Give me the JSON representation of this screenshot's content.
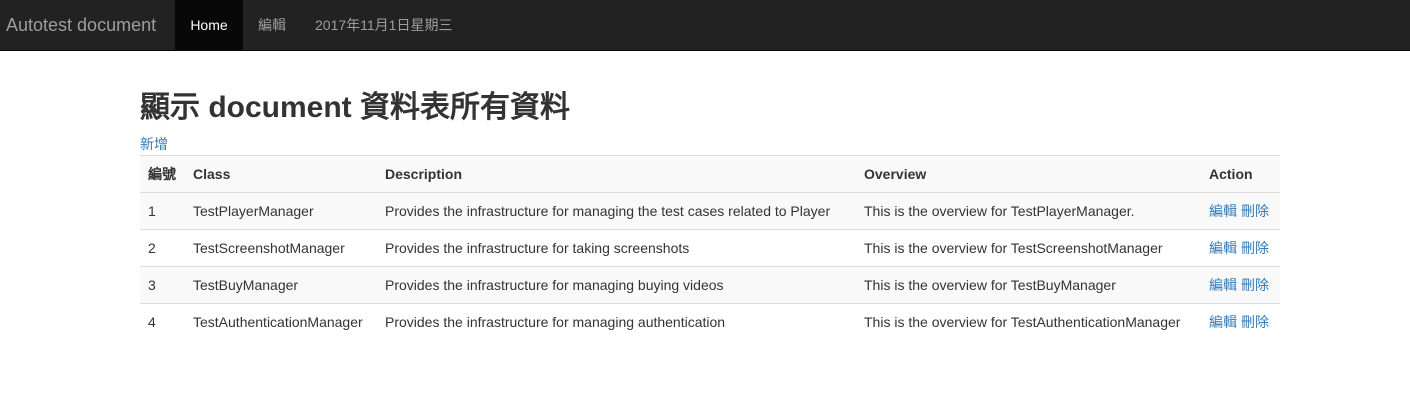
{
  "navbar": {
    "brand": "Autotest document",
    "items": [
      {
        "label": "Home"
      },
      {
        "label": "編輯"
      },
      {
        "label": "2017年11月1日星期三"
      }
    ]
  },
  "main": {
    "title": "顯示 document 資料表所有資料",
    "add_label": "新增",
    "table": {
      "headers": [
        "編號",
        "Class",
        "Description",
        "Overview",
        "Action"
      ],
      "rows": [
        {
          "id": "1",
          "class": "TestPlayerManager",
          "description": "Provides the infrastructure for managing the test cases related to Player",
          "overview": "This is the overview for TestPlayerManager.",
          "edit": "編輯",
          "delete": "刪除"
        },
        {
          "id": "2",
          "class": "TestScreenshotManager",
          "description": "Provides the infrastructure for taking screenshots",
          "overview": "This is the overview for TestScreenshotManager",
          "edit": "編輯",
          "delete": "刪除"
        },
        {
          "id": "3",
          "class": "TestBuyManager",
          "description": "Provides the infrastructure for managing buying videos",
          "overview": "This is the overview for TestBuyManager",
          "edit": "編輯",
          "delete": "刪除"
        },
        {
          "id": "4",
          "class": "TestAuthenticationManager",
          "description": "Provides the infrastructure for managing authentication",
          "overview": "This is the overview for TestAuthenticationManager",
          "edit": "編輯",
          "delete": "刪除"
        }
      ]
    }
  },
  "colors": {
    "navbar_bg": "#222222",
    "active_bg": "#080808",
    "link": "#337ab7"
  }
}
